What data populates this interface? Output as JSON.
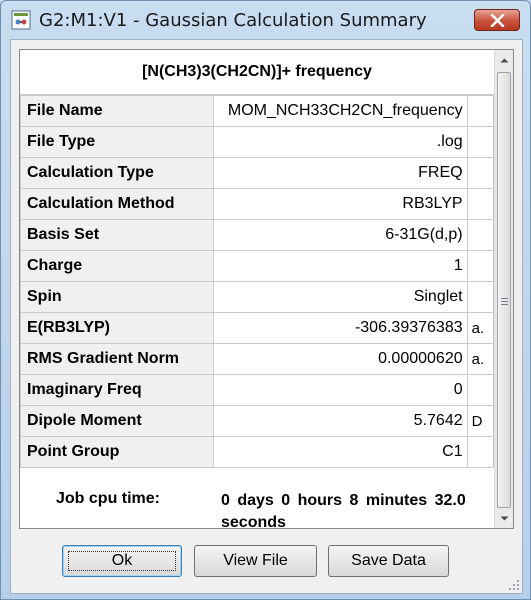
{
  "window": {
    "title": "G2:M1:V1 - Gaussian Calculation Summary"
  },
  "summary": {
    "heading": "[N(CH3)3(CH2CN)]+ frequency",
    "rows": [
      {
        "label": "File Name",
        "value": "MOM_NCH33CH2CN_frequency",
        "unit": ""
      },
      {
        "label": "File Type",
        "value": ".log",
        "unit": ""
      },
      {
        "label": "Calculation Type",
        "value": "FREQ",
        "unit": ""
      },
      {
        "label": "Calculation Method",
        "value": "RB3LYP",
        "unit": ""
      },
      {
        "label": "Basis Set",
        "value": "6-31G(d,p)",
        "unit": ""
      },
      {
        "label": "Charge",
        "value": "1",
        "unit": ""
      },
      {
        "label": "Spin",
        "value": "Singlet",
        "unit": ""
      },
      {
        "label": "E(RB3LYP)",
        "value": "-306.39376383",
        "unit": "a."
      },
      {
        "label": "RMS Gradient Norm",
        "value": "0.00000620",
        "unit": "a."
      },
      {
        "label": "Imaginary Freq",
        "value": "0",
        "unit": ""
      },
      {
        "label": "Dipole Moment",
        "value": "5.7642",
        "unit": "D"
      },
      {
        "label": "Point Group",
        "value": "C1",
        "unit": ""
      }
    ],
    "cpu_label": "Job cpu time:",
    "cpu_value": "0 days 0 hours 8 minutes 32.0 seconds"
  },
  "buttons": {
    "ok": "Ok",
    "view_file": "View File",
    "save_data": "Save Data"
  },
  "icons": {
    "app": "gaussview-app-icon",
    "close": "close-icon"
  },
  "colors": {
    "close_button": "#c7513a",
    "window_frame": "#c9ddf1"
  }
}
